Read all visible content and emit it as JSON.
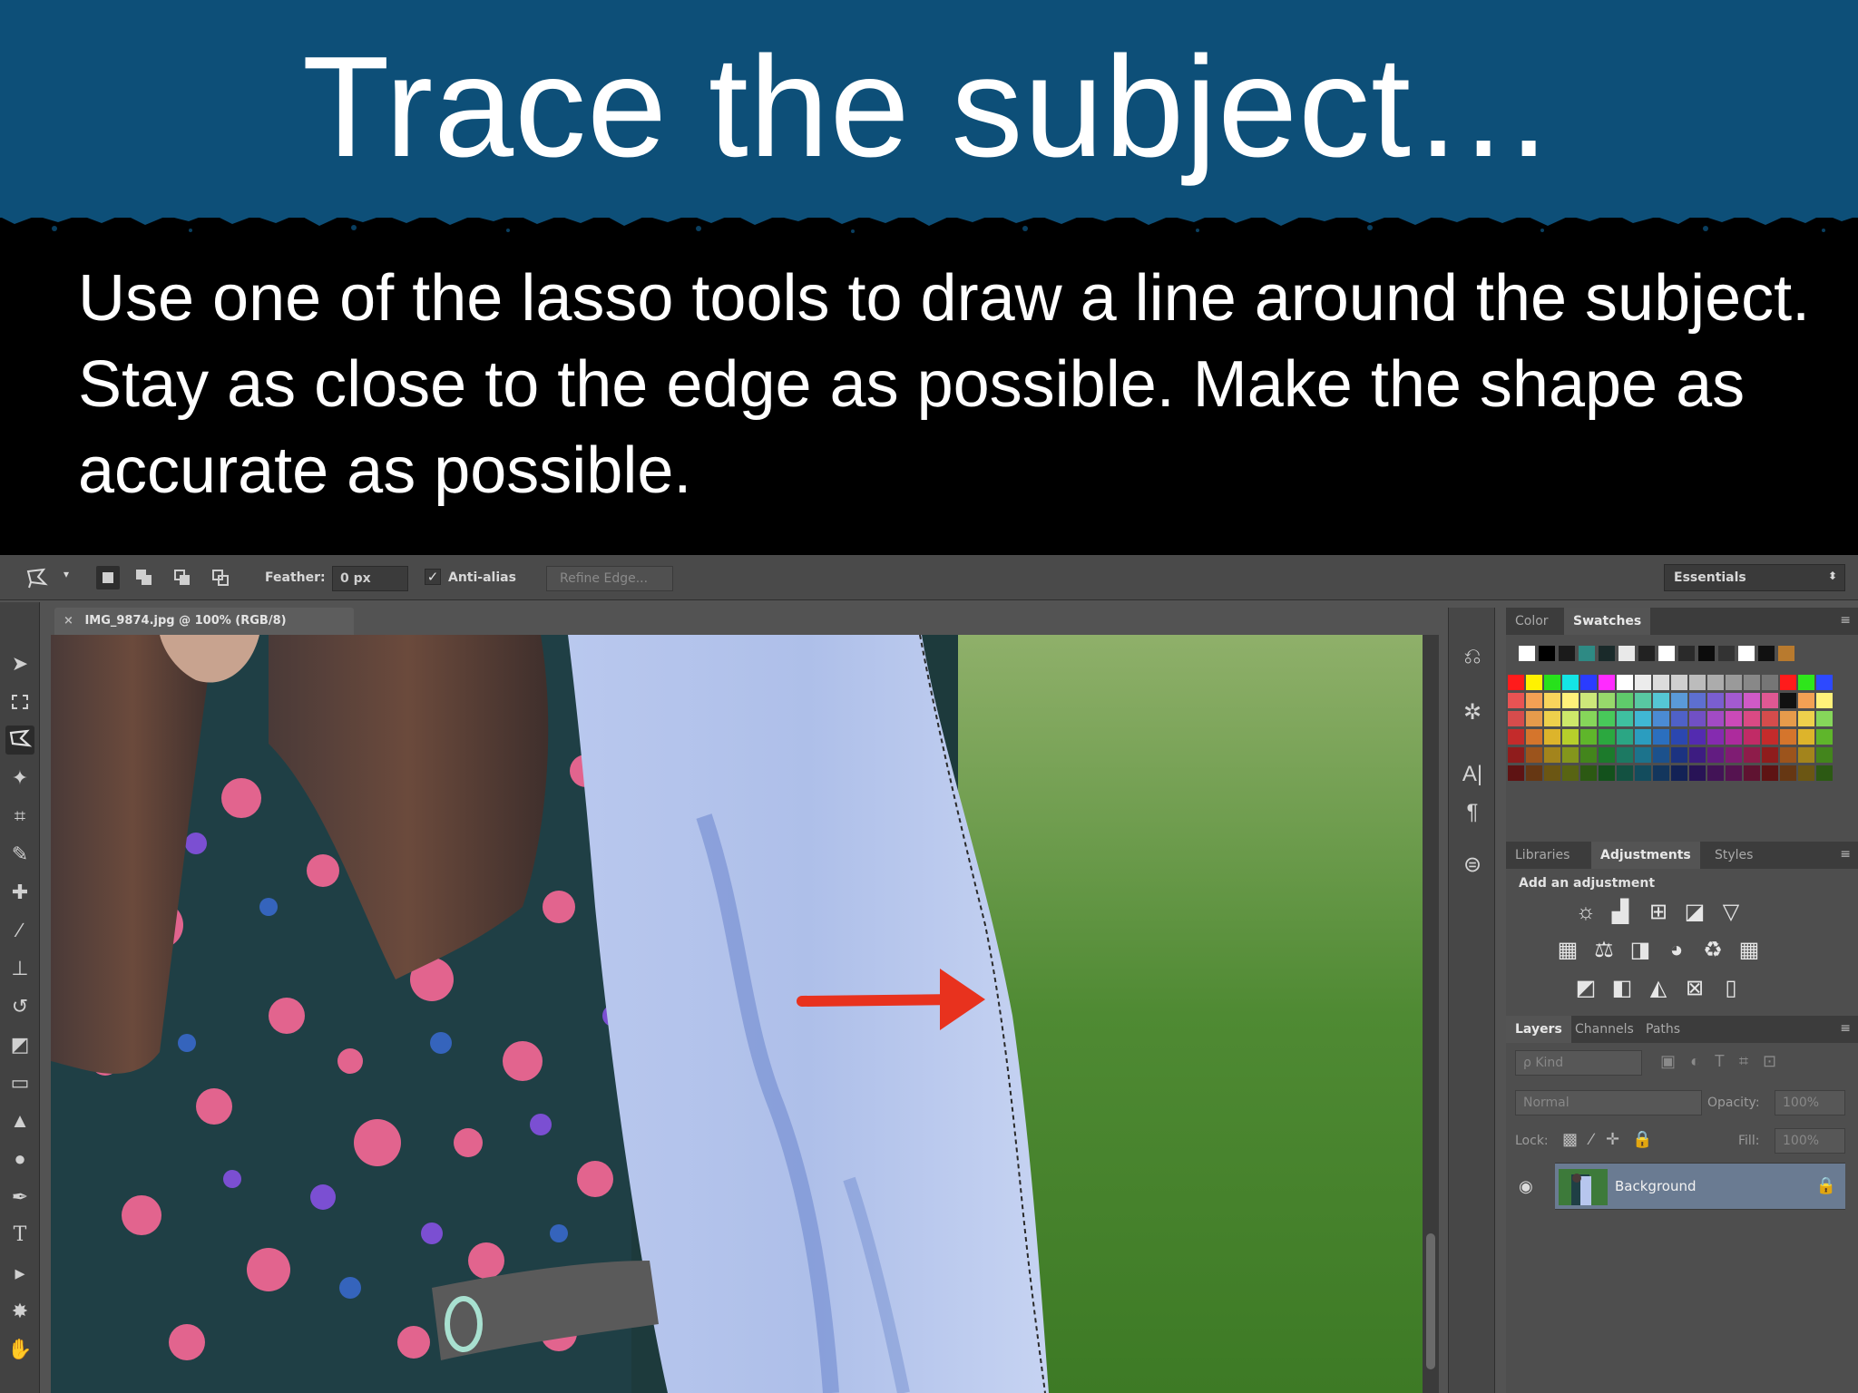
{
  "slide": {
    "title": "Trace the subject…",
    "body": "Use one of the lasso tools to draw a line around the subject. Stay as close to the edge as possible. Make the shape as accurate as possible."
  },
  "options_bar": {
    "feather_label": "Feather:",
    "feather_value": "0 px",
    "antialias_label": "Anti-alias",
    "antialias_checked": true,
    "refine_edge_label": "Refine Edge...",
    "workspace": "Essentials"
  },
  "document": {
    "tab_title": "IMG_9874.jpg @ 100% (RGB/8)",
    "close_glyph": "×"
  },
  "tools": [
    "move",
    "marquee",
    "polygonal-lasso",
    "magic-wand",
    "crop",
    "eyedropper",
    "healing-brush",
    "brush",
    "clone-stamp",
    "history-brush",
    "eraser",
    "gradient",
    "blur",
    "dodge",
    "pen",
    "type",
    "path-selection",
    "shape",
    "hand"
  ],
  "color_panel": {
    "tabs": [
      "Color",
      "Swatches"
    ],
    "active_tab": "Swatches"
  },
  "adjustments_panel": {
    "tabs": [
      "Libraries",
      "Adjustments",
      "Styles"
    ],
    "active_tab": "Adjustments",
    "title": "Add an adjustment"
  },
  "layers_panel": {
    "tabs": [
      "Layers",
      "Channels",
      "Paths"
    ],
    "active_tab": "Layers",
    "filter_kind": "ρ Kind",
    "blend_mode": "Normal",
    "opacity_label": "Opacity:",
    "opacity_value": "100%",
    "lock_label": "Lock:",
    "fill_label": "Fill:",
    "fill_value": "100%",
    "layers": [
      {
        "name": "Background",
        "visible": true,
        "locked": true
      }
    ]
  },
  "annotation": {
    "arrow_color": "#e8321e"
  },
  "colors": {
    "title_band": "#0d4f78",
    "background": "#000000",
    "ps_panel": "#535353",
    "selected_layer": "#6a7b92"
  }
}
